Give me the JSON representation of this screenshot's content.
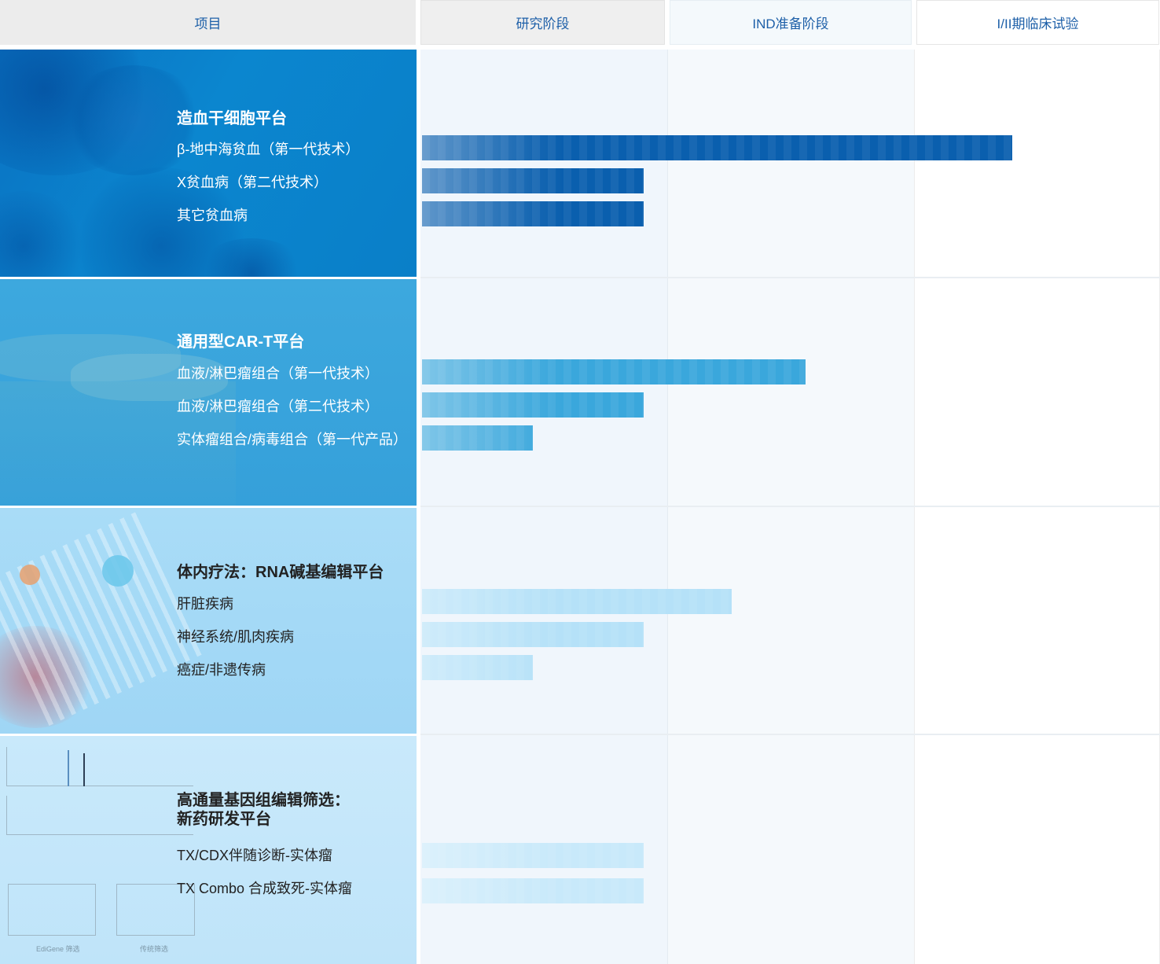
{
  "header": {
    "item": "项目",
    "stage1": "研究阶段",
    "stage2": "IND准备阶段",
    "stage3": "I/II期临床试验"
  },
  "colors": {
    "section1": "#0b7fc9",
    "section2": "#3aa5dc",
    "section3": "#a6daf6",
    "section4": "#c5e7fa",
    "bar1": "#0a5fae",
    "bar2": "#3aa7dc",
    "bar3": "#b5e1f8",
    "bar4": "#c8e9fa"
  },
  "sections": [
    {
      "title": "造血干细胞平台",
      "items": [
        {
          "label": "β-地中海贫血（第一代技术）",
          "progress": 0.8
        },
        {
          "label": "X贫血病（第二代技术）",
          "progress": 0.3
        },
        {
          "label": "其它贫血病",
          "progress": 0.3
        }
      ]
    },
    {
      "title": "通用型CAR-T平台",
      "items": [
        {
          "label": "血液/淋巴瘤组合（第一代技术）",
          "progress": 0.52
        },
        {
          "label": "血液/淋巴瘤组合（第二代技术）",
          "progress": 0.3
        },
        {
          "label": "实体瘤组合/病毒组合（第一代产品）",
          "progress": 0.15
        }
      ]
    },
    {
      "title": "体内疗法：RNA碱基编辑平台",
      "items": [
        {
          "label": "肝脏疾病",
          "progress": 0.42
        },
        {
          "label": "神经系统/肌肉疾病",
          "progress": 0.3
        },
        {
          "label": "癌症/非遗传病",
          "progress": 0.15
        }
      ]
    },
    {
      "title_line1": "高通量基因组编辑筛选：",
      "title_line2": "新药研发平台",
      "items": [
        {
          "label": "TX/CDX伴随诊断-实体瘤",
          "progress": 0.3
        },
        {
          "label": "TX Combo 合成致死-实体瘤",
          "progress": 0.3
        }
      ]
    }
  ],
  "background_captions": {
    "left_chart": "EdiGene 筛选",
    "right_chart": "传统筛选"
  }
}
